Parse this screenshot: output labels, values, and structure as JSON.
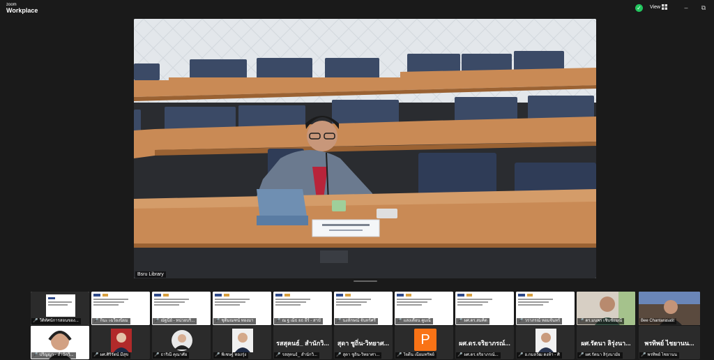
{
  "app": {
    "brand_small": "zoom",
    "brand": "Workplace"
  },
  "header": {
    "view_label": "View",
    "minimize": "–",
    "restore": "⧉"
  },
  "active_speaker": {
    "name": "Bsru Library"
  },
  "gallery_row1": [
    {
      "name": "วีดิทัศน์การสอนของ..."
    },
    {
      "name": "ก็นะ เฉวียงนิยม"
    },
    {
      "name": "ณัฐนีย์ - หน่วยบริ..."
    },
    {
      "name": "ชุติมณฑน์ ทองมา"
    },
    {
      "name": "ณ ฐ เม็ธ ยธ ยีร์ - สาบั"
    },
    {
      "name": "นงลักษณ์ จันทร์ศรี"
    },
    {
      "name": "แสงเดือน คูมณี"
    },
    {
      "name": "ผศ.ดร.สมคิด"
    },
    {
      "name": "วราภรณ์ หอมจันทร์"
    },
    {
      "name": "ดร.มนพร เชิบชัยมณี"
    },
    {
      "name": "Bee Chantarasatit"
    }
  ],
  "gallery_row2": [
    {
      "name": "ปริญญา - สำนักวิ...",
      "display": ""
    },
    {
      "name": "ผศ.ศิริรัตน์ มีสุข",
      "display": ""
    },
    {
      "name": "ธาริณี คุณาศัย",
      "display": ""
    },
    {
      "name": "พิเชษฐ์ ทองรุ่ง",
      "display": ""
    },
    {
      "name": "รสสุคนธ์_ สำนักวิ...",
      "display": "รสสุคนธ์_ สำนักวิ..."
    },
    {
      "name": "สุดา ชูถิ่น-วิทยาศา...",
      "display": "สุดา ชูถิ่น-วิทยาศ..."
    },
    {
      "name": "ใจดีน เนียมทรัพย์",
      "display": "",
      "initial": "P"
    },
    {
      "name": "ผศ.ดร.จริยาภรณ์...",
      "display": "ผศ.ดร.จริยาภรณ์..."
    },
    {
      "name": "อ.กมลวัฒ ดงห้า - ศิ",
      "display": ""
    },
    {
      "name": "ผศ.รัตนา ลิรุ่งนามัย",
      "display": "ผศ.รัตนา ลิรุ่งนา..."
    },
    {
      "name": "พรทิพย์ ไชยานน",
      "display": "พรทิพย์ ไชยานน..."
    }
  ]
}
